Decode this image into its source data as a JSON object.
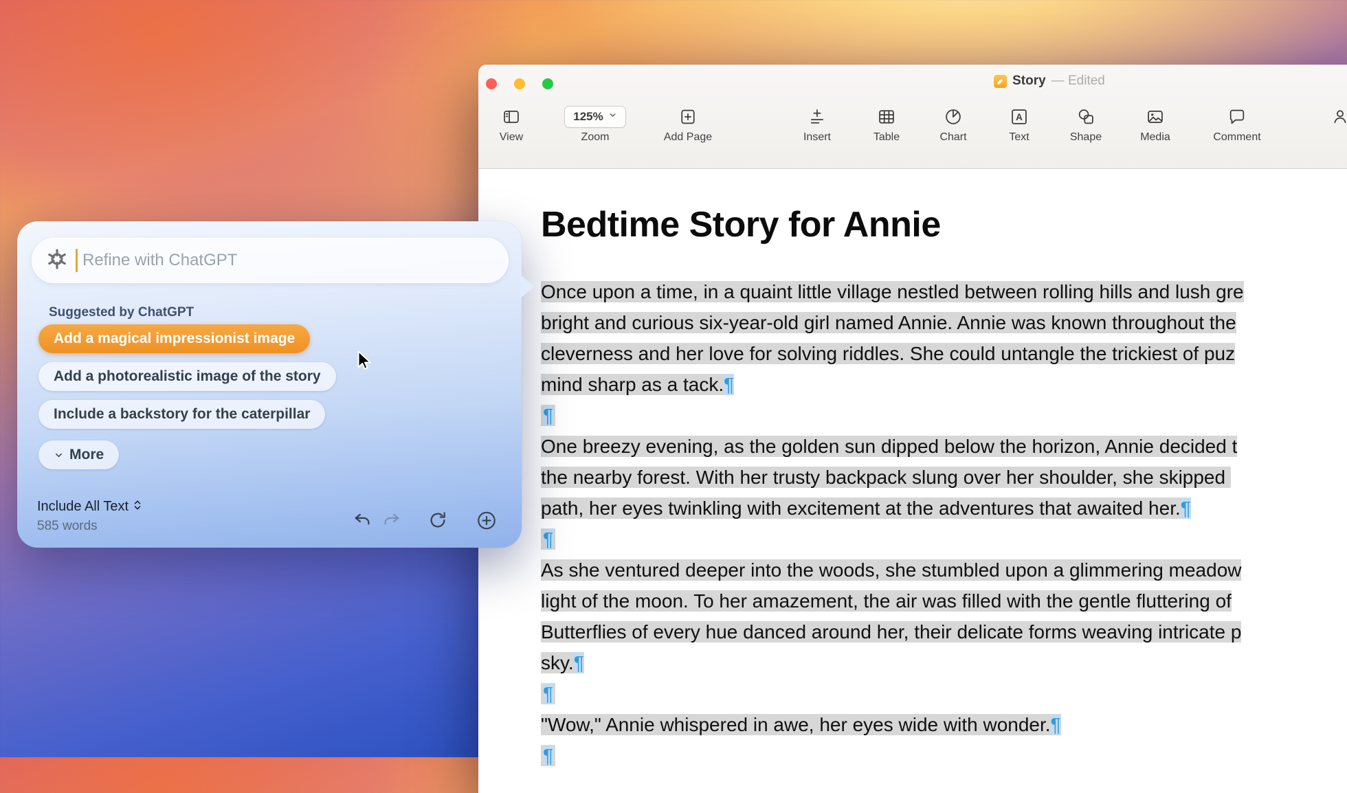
{
  "colors": {
    "accent_orange": "#F09A2D",
    "pilcrow_blue": "#2F9BE2",
    "selection_gray": "#D7D7D7",
    "traffic_red": "#FF5F57",
    "traffic_yellow": "#FEBC2E",
    "traffic_green": "#28C840"
  },
  "window": {
    "title": "Story",
    "title_state": "— Edited",
    "toolbar": [
      {
        "label": "View",
        "icon": "view-icon"
      },
      {
        "label": "Zoom",
        "icon": "chevron-down-icon",
        "value": "125%",
        "type": "zoom"
      },
      {
        "label": "Add Page",
        "icon": "add-page-icon"
      },
      {
        "label": "Insert",
        "icon": "insert-icon"
      },
      {
        "label": "Table",
        "icon": "table-icon"
      },
      {
        "label": "Chart",
        "icon": "chart-icon"
      },
      {
        "label": "Text",
        "icon": "text-icon"
      },
      {
        "label": "Shape",
        "icon": "shape-icon"
      },
      {
        "label": "Media",
        "icon": "media-icon"
      },
      {
        "label": "Comment",
        "icon": "comment-icon"
      }
    ]
  },
  "document": {
    "title": "Bedtime Story for Annie",
    "lines": [
      {
        "t": "Once upon a time, in a quaint little village nestled between rolling hills and lush gre",
        "p": false
      },
      {
        "t": "bright and curious six-year-old girl named Annie. Annie was known throughout the",
        "p": false
      },
      {
        "t": "cleverness and her love for solving riddles. She could untangle the trickiest of puz",
        "p": false
      },
      {
        "t": "mind sharp as a tack.",
        "p": true
      },
      {
        "t": "",
        "p": true
      },
      {
        "t": "One breezy evening, as the golden sun dipped below the horizon, Annie decided t",
        "p": false
      },
      {
        "t": "the nearby forest. With her trusty backpack slung over her shoulder, she skipped ",
        "p": false
      },
      {
        "t": "path, her eyes twinkling with excitement at the adventures that awaited her.",
        "p": true
      },
      {
        "t": "",
        "p": true
      },
      {
        "t": "As she ventured deeper into the woods, she stumbled upon a glimmering meadow",
        "p": false
      },
      {
        "t": "light of the moon. To her amazement, the air was filled with the gentle fluttering of",
        "p": false
      },
      {
        "t": "Butterflies of every hue danced around her, their delicate forms weaving intricate p",
        "p": false
      },
      {
        "t": "sky.",
        "p": true
      },
      {
        "t": "",
        "p": true
      },
      {
        "t": "\"Wow,\" Annie whispered in awe, her eyes wide with wonder.",
        "p": true
      },
      {
        "t": "",
        "p": true
      }
    ]
  },
  "popup": {
    "input_placeholder": "Refine with ChatGPT",
    "logo": "openai-icon",
    "suggested_label": "Suggested by ChatGPT",
    "suggestions": [
      "Add a magical impressionist image",
      "Add a photorealistic image of the story",
      "Include a backstory for the caterpillar"
    ],
    "more_label": "More",
    "scope_label": "Include All Text",
    "word_count": "585 words"
  }
}
